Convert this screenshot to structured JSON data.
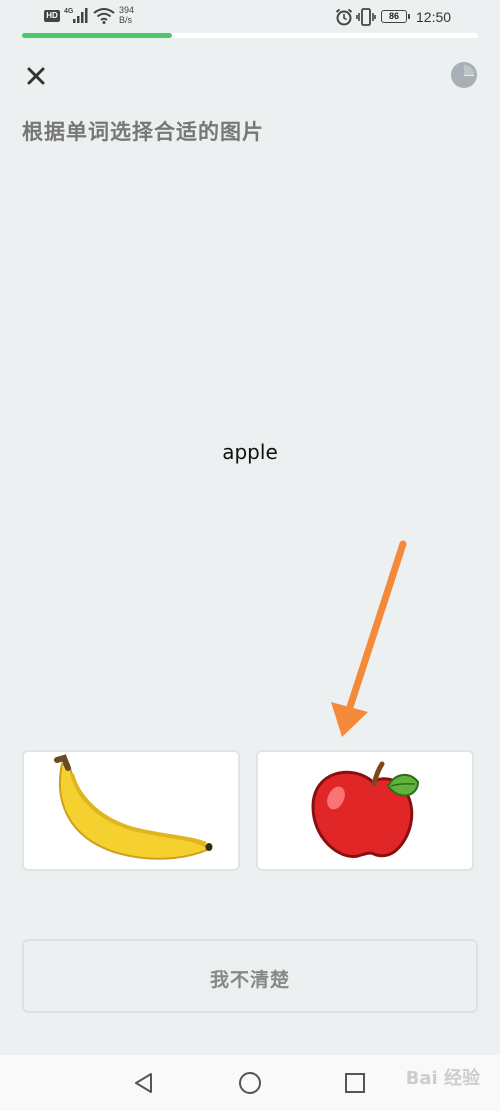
{
  "status_bar": {
    "hd_badge": "HD",
    "network_type": "4G",
    "speed_value": "394",
    "speed_unit": "B/s",
    "battery": "86",
    "time": "12:50"
  },
  "progress": {
    "fraction": 0.33
  },
  "header": {
    "instruction": "根据单词选择合适的图片"
  },
  "question": {
    "word": "apple"
  },
  "options": [
    {
      "id": "banana",
      "icon": "banana-image"
    },
    {
      "id": "apple",
      "icon": "apple-image"
    }
  ],
  "actions": {
    "unsure_label": "我不清楚"
  },
  "watermark": {
    "text": "Bai 经验"
  },
  "colors": {
    "progress": "#4cc86a",
    "arrow": "#f5893a",
    "background": "#ecf0f0"
  }
}
